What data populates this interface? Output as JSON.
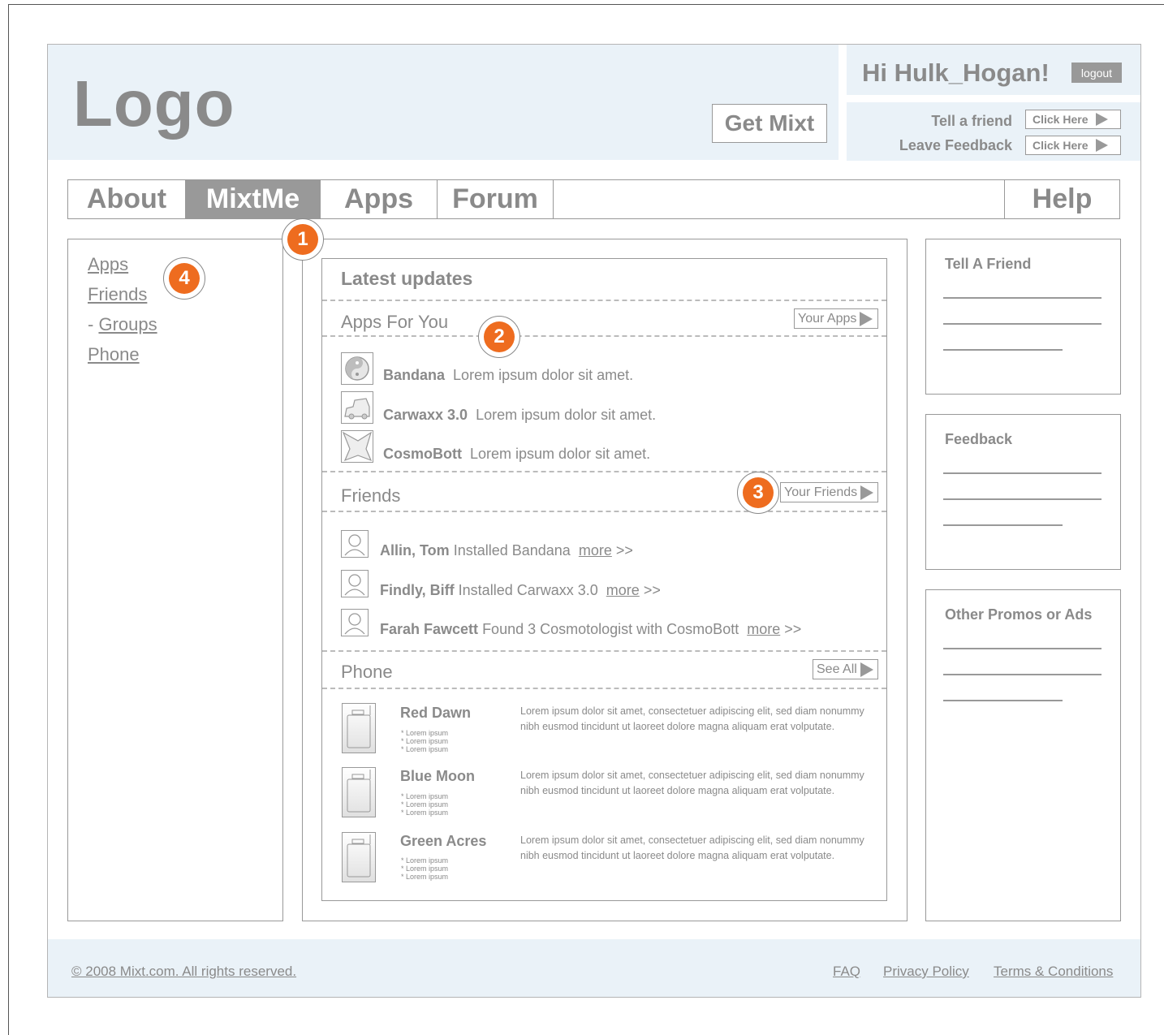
{
  "header": {
    "logo": "Logo",
    "get_mixt": "Get Mixt",
    "greeting": "Hi Hulk_Hogan!",
    "logout": "logout",
    "tell_friend_label": "Tell a friend",
    "leave_feedback_label": "Leave Feedback",
    "click_here_1": "Click Here",
    "click_here_2": "Click Here"
  },
  "nav": {
    "items": [
      "About",
      "MixtMe",
      "Apps",
      "Forum"
    ],
    "help": "Help",
    "active": "MixtMe"
  },
  "markers": [
    "1",
    "2",
    "3",
    "4"
  ],
  "left_nav": {
    "apps": "Apps",
    "friends": "Friends",
    "groups_prefix": "- ",
    "groups": "Groups",
    "phone": "Phone"
  },
  "main": {
    "title": "Latest updates",
    "apps_section": {
      "title": "Apps For You",
      "button": "Your Apps",
      "items": [
        {
          "name": "Bandana",
          "text": "Lorem ipsum dolor sit amet.",
          "icon": "yin-yang-icon"
        },
        {
          "name": "Carwaxx 3.0",
          "text": "Lorem ipsum dolor sit amet.",
          "icon": "car-icon"
        },
        {
          "name": "CosmoBott",
          "text": "Lorem ipsum dolor sit amet.",
          "icon": "star-icon"
        }
      ]
    },
    "friends_section": {
      "title": "Friends",
      "button": "Your Friends",
      "items": [
        {
          "name": "Allin, Tom",
          "text": "Installed Bandana",
          "more": "more",
          "arrows": ">>"
        },
        {
          "name": "Findly, Biff",
          "text": "Installed Carwaxx 3.0",
          "more": "more",
          "arrows": ">>"
        },
        {
          "name": "Farah Fawcett",
          "text": "Found 3 Cosmotologist with CosmoBott",
          "more": "more",
          "arrows": ">>"
        }
      ]
    },
    "phone_section": {
      "title": "Phone",
      "button": "See All",
      "items": [
        {
          "name": "Red Dawn",
          "bullets": [
            "* Lorem ipsum",
            "* Lorem ipsum",
            "* Lorem ipsum"
          ],
          "desc": "Lorem ipsum dolor sit amet, consectetuer adipiscing elit, sed diam nonummy nibh eusmod tincidunt ut laoreet dolore magna aliquam erat volputate."
        },
        {
          "name": "Blue Moon",
          "bullets": [
            "* Lorem ipsum",
            "* Lorem ipsum",
            "* Lorem ipsum"
          ],
          "desc": "Lorem ipsum dolor sit amet, consectetuer adipiscing elit, sed diam nonummy nibh eusmod tincidunt ut laoreet dolore magna aliquam erat volputate."
        },
        {
          "name": "Green Acres",
          "bullets": [
            "* Lorem ipsum",
            "* Lorem ipsum",
            "* Lorem ipsum"
          ],
          "desc": "Lorem ipsum dolor sit amet, consectetuer adipiscing elit, sed diam nonummy nibh eusmod tincidunt ut laoreet dolore magna aliquam erat volputate."
        }
      ]
    }
  },
  "sidebar": {
    "boxes": [
      {
        "title": "Tell A Friend"
      },
      {
        "title": "Feedback"
      },
      {
        "title": "Other Promos or Ads"
      }
    ]
  },
  "footer": {
    "copyright": "© 2008 Mixt.com. All rights reserved.",
    "faq": "FAQ",
    "privacy": "Privacy Policy",
    "terms": "Terms & Conditions"
  },
  "colors": {
    "header_bg": "#eaf2f8",
    "marker": "#ee6c1f",
    "active_tab": "#999999"
  }
}
